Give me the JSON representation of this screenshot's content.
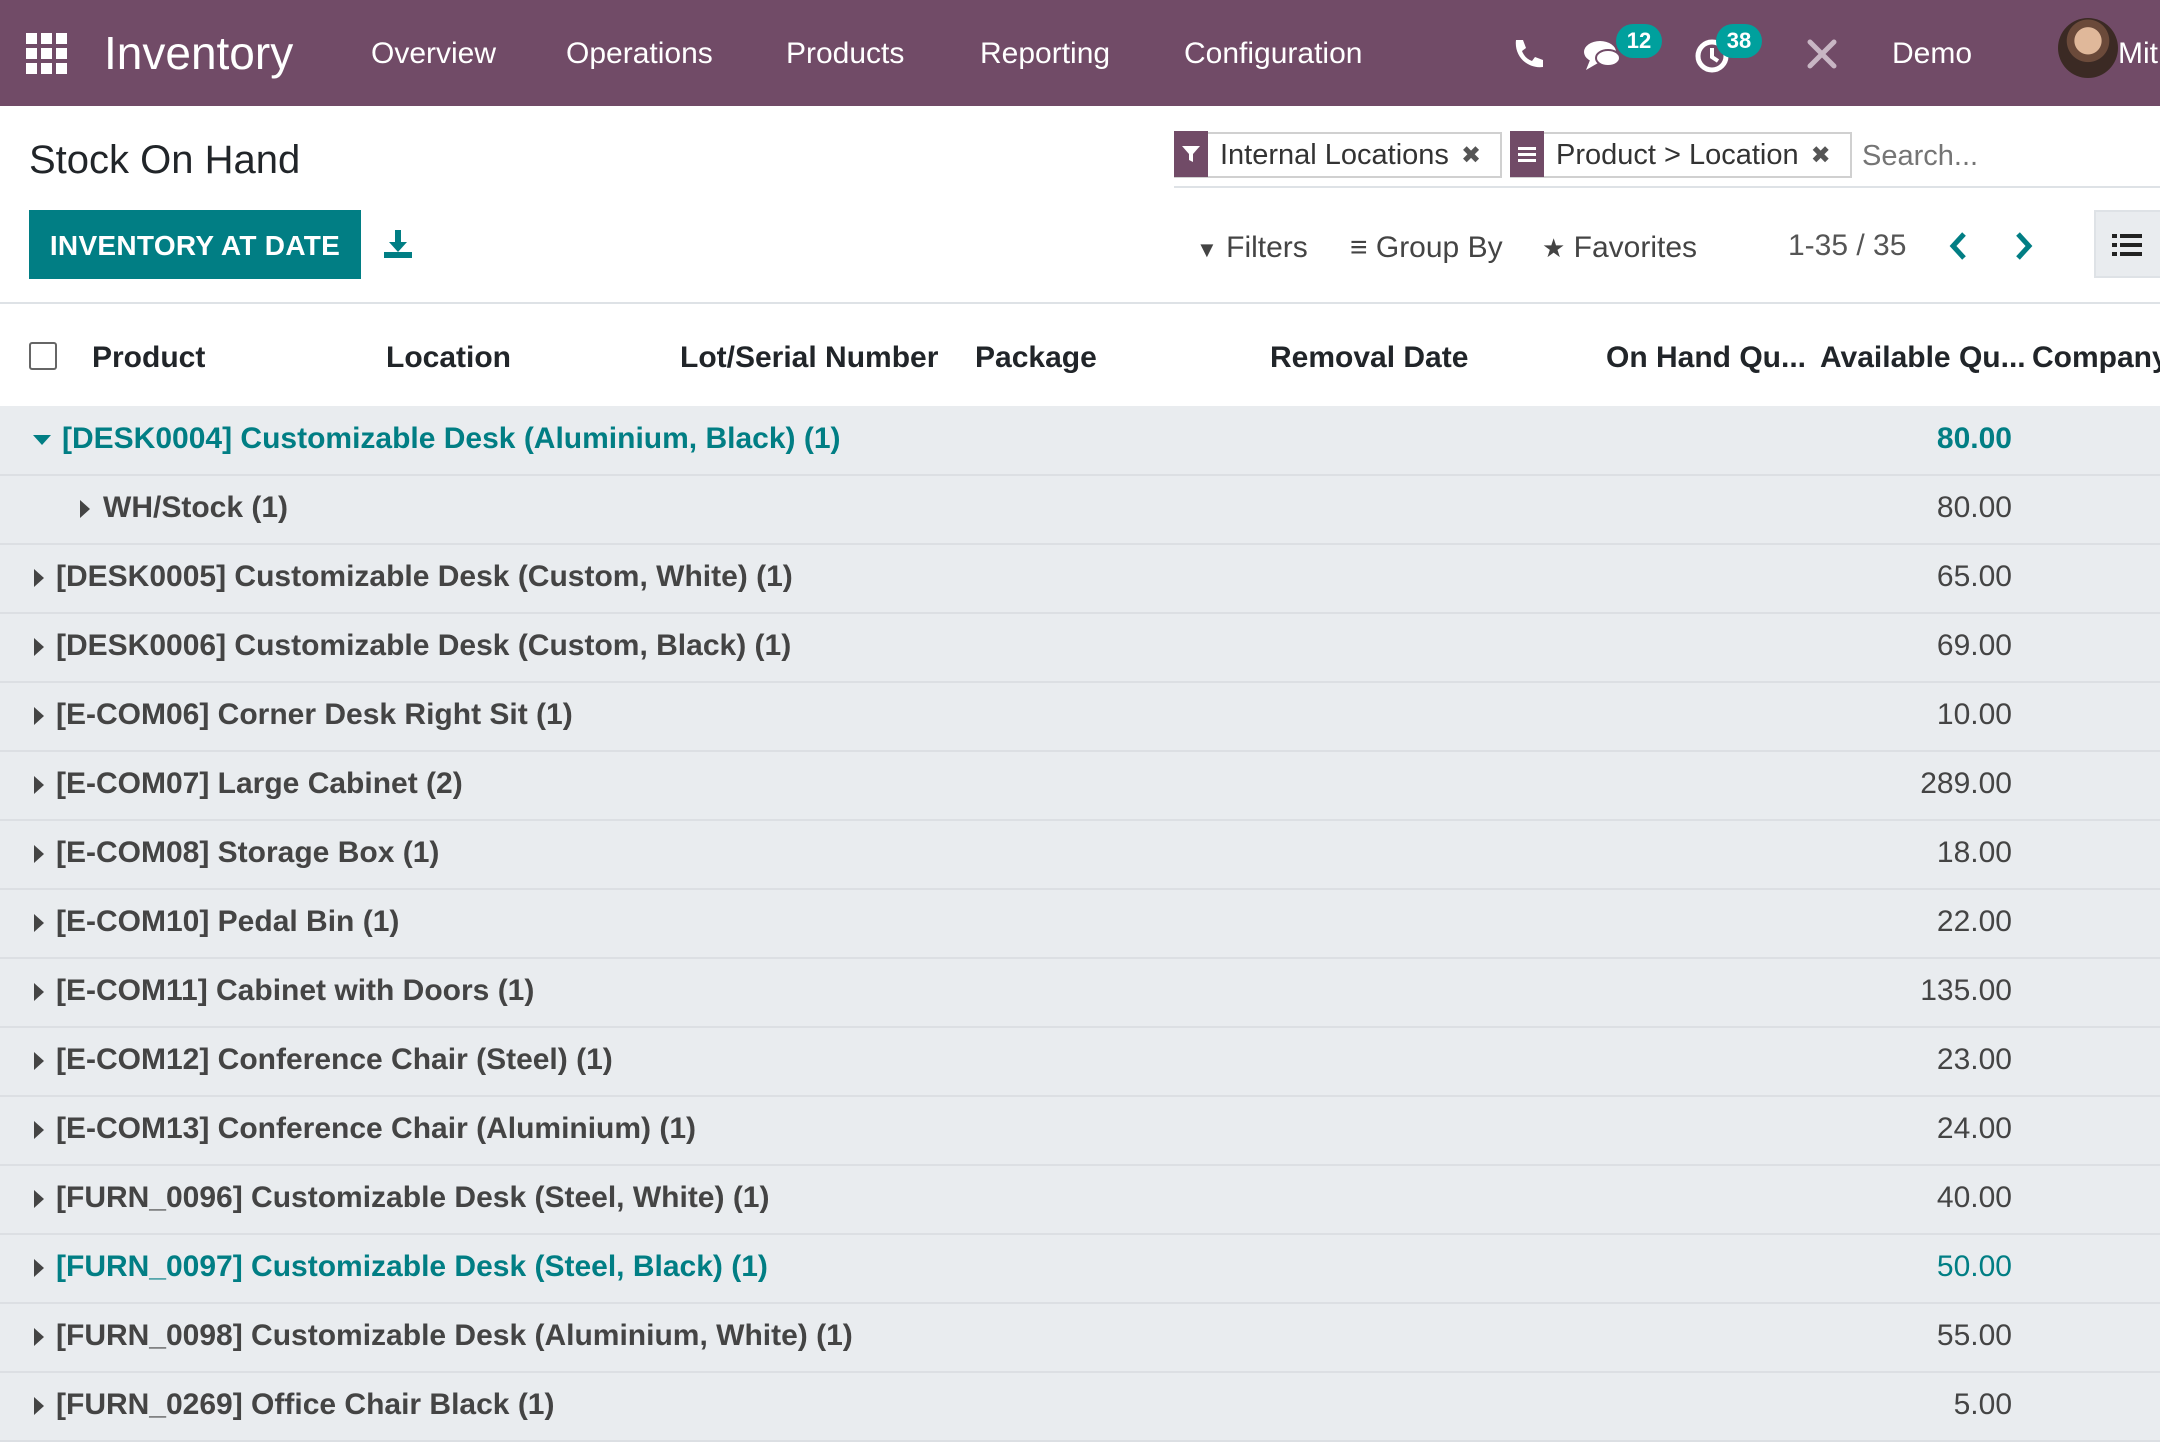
{
  "navbar": {
    "app_name": "Inventory",
    "menus": [
      "Overview",
      "Operations",
      "Products",
      "Reporting",
      "Configuration"
    ],
    "messages_count": "12",
    "activities_count": "38",
    "company": "Demo",
    "user": "Mit",
    "icons": [
      "apps-grid-icon",
      "phone-icon",
      "chat-icon",
      "clock-icon",
      "tools-icon"
    ]
  },
  "control_panel": {
    "title": "Stock On Hand",
    "primary_button": "INVENTORY AT DATE",
    "facets": [
      {
        "label": "Internal Locations",
        "icon": "filter-icon"
      },
      {
        "label": "Product > Location",
        "icon": "group-by-icon"
      }
    ],
    "search_placeholder": "Search...",
    "filters_label": "Filters",
    "group_by_label": "Group By",
    "favorites_label": "Favorites",
    "pager": "1-35 / 35"
  },
  "table": {
    "columns": [
      "Product",
      "Location",
      "Lot/Serial Number",
      "Package",
      "Removal Date",
      "On Hand Qu...",
      "Available Qu...",
      "Company"
    ],
    "rows": [
      {
        "label": "[DESK0004] Customizable Desk (Aluminium, Black) (1)",
        "qty": "80.00",
        "expanded": true,
        "level": 0,
        "highlight": true
      },
      {
        "label": "WH/Stock (1)",
        "qty": "80.00",
        "expanded": false,
        "level": 1,
        "highlight": false
      },
      {
        "label": "[DESK0005] Customizable Desk (Custom, White) (1)",
        "qty": "65.00",
        "expanded": false,
        "level": 0,
        "highlight": false
      },
      {
        "label": "[DESK0006] Customizable Desk (Custom, Black) (1)",
        "qty": "69.00",
        "expanded": false,
        "level": 0,
        "highlight": false
      },
      {
        "label": "[E-COM06] Corner Desk Right Sit (1)",
        "qty": "10.00",
        "expanded": false,
        "level": 0,
        "highlight": false
      },
      {
        "label": "[E-COM07] Large Cabinet (2)",
        "qty": "289.00",
        "expanded": false,
        "level": 0,
        "highlight": false
      },
      {
        "label": "[E-COM08] Storage Box (1)",
        "qty": "18.00",
        "expanded": false,
        "level": 0,
        "highlight": false
      },
      {
        "label": "[E-COM10] Pedal Bin (1)",
        "qty": "22.00",
        "expanded": false,
        "level": 0,
        "highlight": false
      },
      {
        "label": "[E-COM11] Cabinet with Doors (1)",
        "qty": "135.00",
        "expanded": false,
        "level": 0,
        "highlight": false
      },
      {
        "label": "[E-COM12] Conference Chair (Steel) (1)",
        "qty": "23.00",
        "expanded": false,
        "level": 0,
        "highlight": false
      },
      {
        "label": "[E-COM13] Conference Chair (Aluminium) (1)",
        "qty": "24.00",
        "expanded": false,
        "level": 0,
        "highlight": false
      },
      {
        "label": "[FURN_0096] Customizable Desk (Steel, White) (1)",
        "qty": "40.00",
        "expanded": false,
        "level": 0,
        "highlight": false
      },
      {
        "label": "[FURN_0097] Customizable Desk (Steel, Black) (1)",
        "qty": "50.00",
        "expanded": false,
        "level": 0,
        "highlight": true
      },
      {
        "label": "[FURN_0098] Customizable Desk (Aluminium, White) (1)",
        "qty": "55.00",
        "expanded": false,
        "level": 0,
        "highlight": false
      },
      {
        "label": "[FURN_0269] Office Chair Black (1)",
        "qty": "5.00",
        "expanded": false,
        "level": 0,
        "highlight": false
      }
    ]
  },
  "colors": {
    "navbar": "#714b67",
    "primary": "#017e84",
    "badge": "#00a09d",
    "group_row_bg": "#e9ecef"
  }
}
